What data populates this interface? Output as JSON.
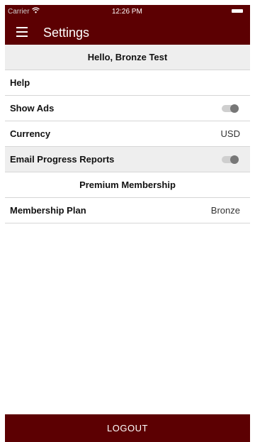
{
  "status_bar": {
    "carrier": "Carrier",
    "wifi_icon": "wifi-icon",
    "time": "12:26 PM",
    "battery_icon": "battery-icon"
  },
  "header": {
    "menu_icon": "hamburger-menu-icon",
    "title": "Settings",
    "background": "#5c0002"
  },
  "rows": {
    "greeting": "Hello, Bronze Test",
    "help": "Help",
    "show_ads": {
      "label": "Show Ads",
      "toggle_on": false
    },
    "currency": {
      "label": "Currency",
      "value": "USD"
    },
    "email_progress": {
      "label": "Email Progress Reports",
      "toggle_on": false
    },
    "premium_section": "Premium Membership",
    "membership_plan": {
      "label": "Membership Plan",
      "value": "Bronze"
    }
  },
  "footer": {
    "logout_label": "LOGOUT"
  }
}
